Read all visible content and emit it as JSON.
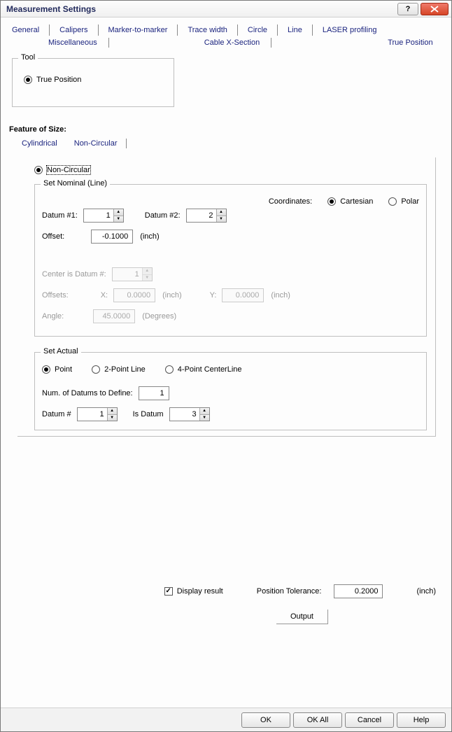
{
  "window": {
    "title": "Measurement Settings",
    "help_glyph": "?",
    "close_glyph": "×"
  },
  "tabs": {
    "row1": [
      "General",
      "Calipers",
      "Marker-to-marker",
      "Trace width",
      "Circle",
      "Line",
      "LASER profiling"
    ],
    "row2": [
      "Miscellaneous",
      "Cable X-Section",
      "True Position"
    ]
  },
  "tool": {
    "legend": "Tool",
    "true_position_label": "True Position",
    "true_position_checked": true
  },
  "feature_of_size": {
    "title": "Feature of Size:",
    "subtabs": [
      "Cylindrical",
      "Non-Circular"
    ],
    "non_circular": {
      "radio_label": "Non-Circular",
      "checked": true,
      "nominal": {
        "legend": "Set Nominal (Line)",
        "coords_label": "Coordinates:",
        "cartesian_label": "Cartesian",
        "cartesian_checked": true,
        "polar_label": "Polar",
        "polar_checked": false,
        "datum1_label": "Datum #1:",
        "datum1_value": "1",
        "datum2_label": "Datum #2:",
        "datum2_value": "2",
        "offset_label": "Offset:",
        "offset_value": "-0.1000",
        "offset_unit": "(inch)",
        "center_label": "Center is Datum #:",
        "center_value": "1",
        "offsets_label": "Offsets:",
        "x_label": "X:",
        "x_value": "0.0000",
        "x_unit": "(inch)",
        "y_label": "Y:",
        "y_value": "0.0000",
        "y_unit": "(inch)",
        "angle_label": "Angle:",
        "angle_value": "45.0000",
        "angle_unit": "(Degrees)"
      },
      "actual": {
        "legend": "Set Actual",
        "point_label": "Point",
        "point_checked": true,
        "two_point_label": "2-Point Line",
        "two_point_checked": false,
        "four_point_label": "4-Point CenterLine",
        "four_point_checked": false,
        "num_datums_label": "Num. of Datums to Define:",
        "num_datums_value": "1",
        "datum_num_label": "Datum #",
        "datum_num_value": "1",
        "is_datum_label": "Is Datum",
        "is_datum_value": "3"
      }
    }
  },
  "display_result": {
    "label": "Display result",
    "checked": true,
    "pos_tol_label": "Position Tolerance:",
    "pos_tol_value": "0.2000",
    "pos_tol_unit": "(inch)",
    "output_label": "Output"
  },
  "buttons": {
    "ok": "OK",
    "ok_all": "OK All",
    "cancel": "Cancel",
    "help": "Help"
  }
}
